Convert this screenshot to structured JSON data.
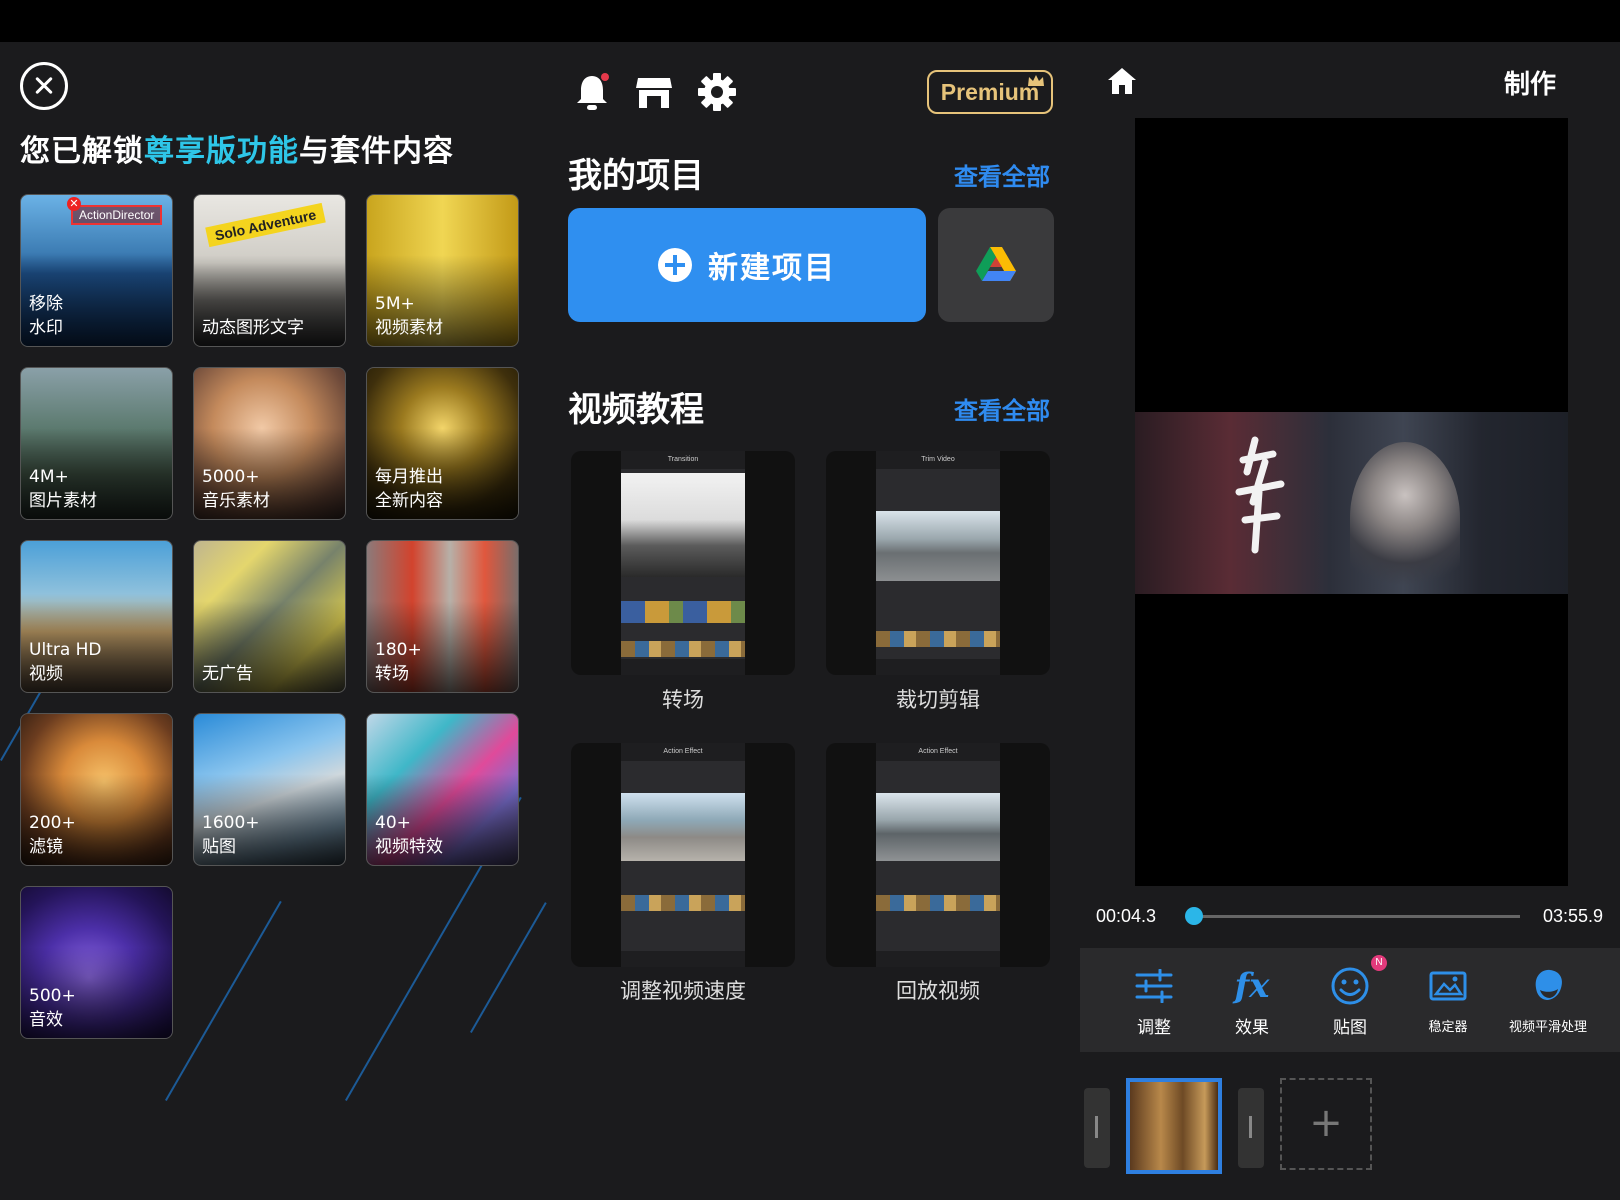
{
  "left": {
    "title_prefix": "您已解锁",
    "title_highlight": "尊享版功能",
    "title_suffix": "与套件内容",
    "watermark_badge": "ActionDirector",
    "solo_tag": "Solo Adventure",
    "tiles": [
      {
        "label": "移除\n水印"
      },
      {
        "label": "动态图形文字"
      },
      {
        "label": "5M+\n视频素材"
      },
      {
        "label": "4M+\n图片素材"
      },
      {
        "label": "5000+\n音乐素材"
      },
      {
        "label": "每月推出\n全新内容"
      },
      {
        "label": "Ultra HD\n视频"
      },
      {
        "label": "无广告"
      },
      {
        "label": "180+\n转场"
      },
      {
        "label": "200+\n滤镜"
      },
      {
        "label": "1600+\n贴图"
      },
      {
        "label": "40+\n视频特效"
      },
      {
        "label": "500+\n音效"
      }
    ]
  },
  "middle": {
    "premium_label": "Premium",
    "my_projects_title": "我的项目",
    "view_all_projects": "查看全部",
    "new_project_label": "新建项目",
    "tutorials_title": "视频教程",
    "view_all_tutorials": "查看全部",
    "tutorials": [
      {
        "label": "转场",
        "screen_title": "Transition"
      },
      {
        "label": "裁切剪辑",
        "screen_title": "Trim Video"
      },
      {
        "label": "调整视频速度",
        "screen_title": "Action Effect"
      },
      {
        "label": "回放视频",
        "screen_title": "Action Effect"
      }
    ]
  },
  "right": {
    "make_label": "制作",
    "current_time": "00:04.3",
    "total_time": "03:55.9",
    "progress": 0.018,
    "tools": [
      {
        "label": "调整",
        "icon": "sliders-icon"
      },
      {
        "label": "效果",
        "icon": "fx-icon"
      },
      {
        "label": "贴图",
        "icon": "smiley-icon",
        "badge": "N"
      },
      {
        "label": "稳定器",
        "icon": "stabilizer-icon"
      },
      {
        "label": "视频平滑处理",
        "icon": "smooth-face-icon"
      }
    ]
  }
}
